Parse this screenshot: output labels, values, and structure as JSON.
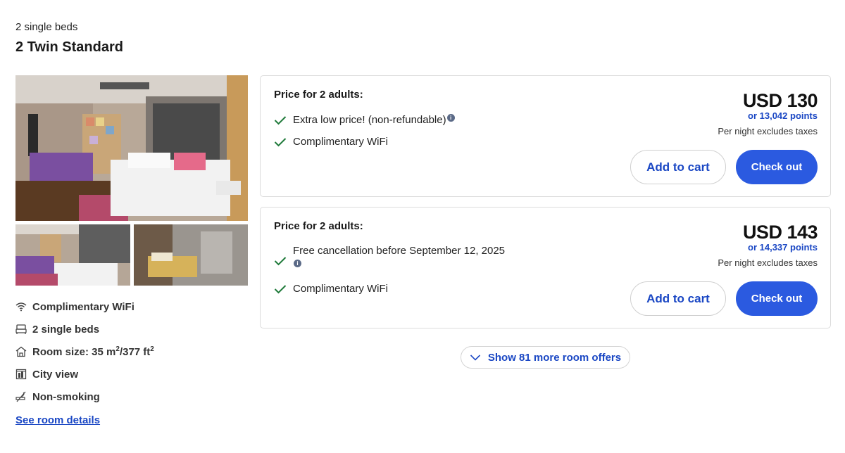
{
  "room": {
    "bed_summary": "2 single beds",
    "name": "2 Twin Standard",
    "amenities": {
      "wifi": "Complimentary WiFi",
      "beds": "2 single beds",
      "size_prefix": "Room size: 35 m",
      "size_mid": "/377 ft",
      "size_sup": "2",
      "view": "City view",
      "smoking": "Non-smoking"
    },
    "details_link": "See room details"
  },
  "offers": [
    {
      "heading": "Price for 2 adults:",
      "features": [
        "Extra low price! (non-refundable)",
        "Complimentary WiFi"
      ],
      "price": "USD 130",
      "points": "or 13,042 points",
      "price_note": "Per night excludes taxes",
      "add_to_cart": "Add to cart",
      "checkout": "Check out"
    },
    {
      "heading": "Price for 2 adults:",
      "features": [
        "Free cancellation before September 12, 2025",
        "Complimentary WiFi"
      ],
      "price": "USD 143",
      "points": "or 14,337 points",
      "price_note": "Per night excludes taxes",
      "add_to_cart": "Add to cart",
      "checkout": "Check out"
    }
  ],
  "show_more": "Show 81 more room offers",
  "icons": [
    "wifi-icon",
    "bed-icon",
    "room-size-icon",
    "city-view-icon",
    "non-smoking-icon",
    "check-icon",
    "info-icon",
    "chevron-down-icon"
  ],
  "colors": {
    "link": "#1a47c4",
    "primary_button": "#2b5ae0",
    "check": "#1f7a3a"
  }
}
